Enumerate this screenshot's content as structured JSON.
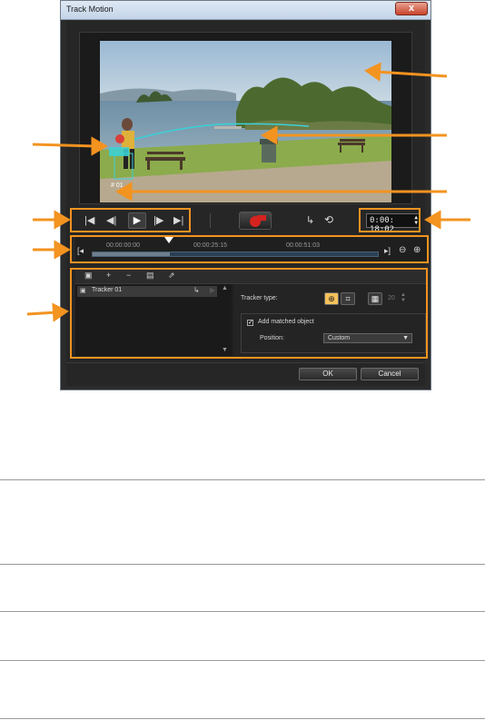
{
  "window": {
    "title": "Track Motion",
    "close_label": "x"
  },
  "transport": {
    "buttons": [
      {
        "name": "go-to-start",
        "glyph": "|◀"
      },
      {
        "name": "step-back",
        "glyph": "◀|"
      },
      {
        "name": "play",
        "glyph": "▶"
      },
      {
        "name": "step-forward",
        "glyph": "|▶"
      },
      {
        "name": "go-to-end",
        "glyph": "▶|"
      }
    ],
    "timecode": "0:00: 18:02",
    "icons": [
      "track-motion-icon",
      "reset-history-icon"
    ]
  },
  "timeline": {
    "tick_labels": [
      "00:00:00:00",
      "00:00:25:15",
      "00:00:51:03"
    ],
    "playhead_fraction": 0.27
  },
  "tracker_panel": {
    "list": [
      {
        "label": "Tracker 01"
      }
    ],
    "tracker_type_label": "Tracker type:",
    "spot_size_value": "20",
    "add_matched_object_label": "Add matched object",
    "add_matched_object_checked": true,
    "position_label": "Position:",
    "position_value": "Custom"
  },
  "footer": {
    "ok_label": "OK",
    "cancel_label": "Cancel"
  },
  "preview": {
    "tracker_label": "# 01"
  },
  "colors": {
    "highlight": "#f39320",
    "tracker_path": "#39d1d8",
    "record": "#d6231f"
  }
}
